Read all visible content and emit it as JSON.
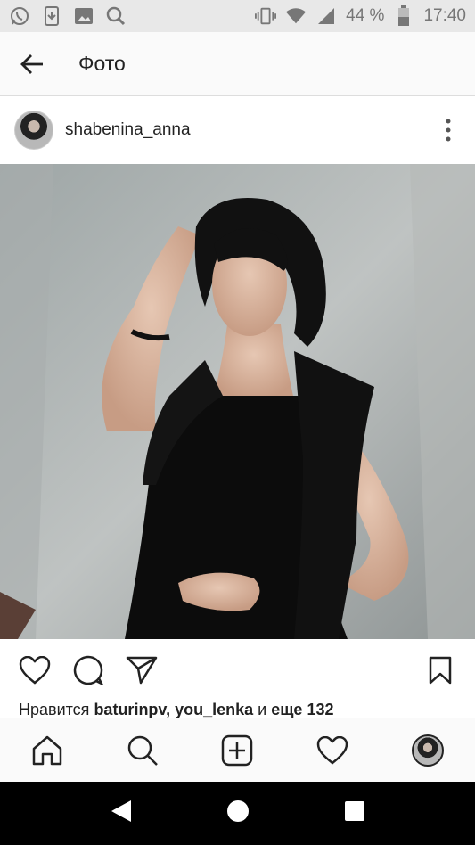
{
  "status_bar": {
    "battery": "44 %",
    "time": "17:40",
    "icons": [
      "whatsapp-icon",
      "download-icon",
      "image-icon",
      "search-icon",
      "vibrate-icon",
      "wifi-icon",
      "signal-icon",
      "battery-icon"
    ]
  },
  "app_bar": {
    "title": "Фото"
  },
  "post": {
    "username": "shabenina_anna",
    "likes_prefix": "Нравится ",
    "likes_user1": "baturinpv",
    "likes_sep": ", ",
    "likes_user2": "you_lenka",
    "likes_and": " и ",
    "likes_more": "еще 132"
  },
  "colors": {
    "background": "#ffffff",
    "text": "#222222",
    "status_bar": "#e8e8e8",
    "system_nav": "#000000"
  }
}
